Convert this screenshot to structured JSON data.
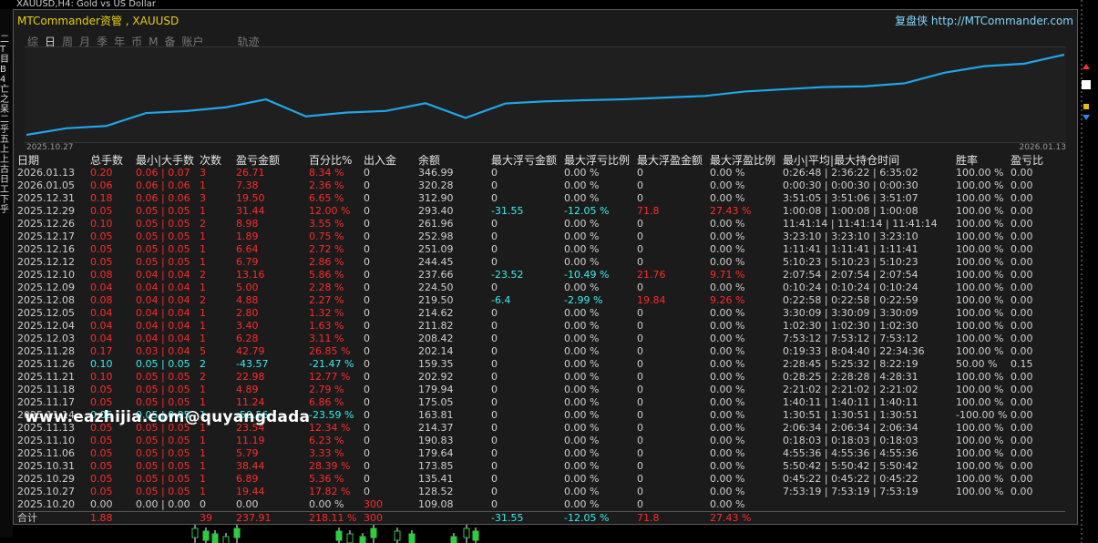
{
  "background": {
    "chart_title": "XAUUSD,H4:  Gold vs US Dollar",
    "left_labels": [
      "二",
      "T",
      "目",
      "B",
      "4",
      "亡",
      "之",
      "呆",
      "二",
      "乎",
      "五",
      "上",
      "上",
      "古",
      "日",
      "工",
      "下",
      "乎"
    ]
  },
  "panel": {
    "title": "MTCommander资管 , XAUUSD",
    "brand": "复盘侠",
    "link": "http://MTCommander.com",
    "tabs": [
      {
        "label": "综"
      },
      {
        "label": "日",
        "active": true
      },
      {
        "label": "周"
      },
      {
        "label": "月"
      },
      {
        "label": "季"
      },
      {
        "label": "年"
      },
      {
        "label": "币"
      },
      {
        "label": "M"
      },
      {
        "label": "备"
      },
      {
        "label": "账户"
      },
      {
        "label": "轨迹"
      }
    ]
  },
  "equity_chart": {
    "date_start": "2025.10.27",
    "date_end": "2026.01.13",
    "line_color": "#1ea6e8"
  },
  "chart_data": {
    "type": "line",
    "x": [
      "2025.10.20",
      "2025.10.27",
      "2025.10.29",
      "2025.10.31",
      "2025.11.06",
      "2025.11.10",
      "2025.11.13",
      "2025.11.14",
      "2025.11.17",
      "2025.11.18",
      "2025.11.21",
      "2025.11.26",
      "2025.11.28",
      "2025.12.03",
      "2025.12.04",
      "2025.12.05",
      "2025.12.08",
      "2025.12.09",
      "2025.12.10",
      "2025.12.12",
      "2025.12.16",
      "2025.12.17",
      "2025.12.26",
      "2025.12.29",
      "2025.12.31",
      "2026.01.05",
      "2026.01.13"
    ],
    "series": [
      {
        "values": [
          109.08,
          128.52,
          135.41,
          173.85,
          179.64,
          190.83,
          214.37,
          163.81,
          175.05,
          179.94,
          202.92,
          159.35,
          202.14,
          208.42,
          211.82,
          214.62,
          219.5,
          224.5,
          237.66,
          244.45,
          251.09,
          252.98,
          261.96,
          293.4,
          312.9,
          320.28,
          346.99
        ]
      }
    ]
  },
  "table": {
    "headers": [
      "日期",
      "总手数",
      "最小|大手数",
      "次数",
      "盈亏金额",
      "百分比%",
      "出入金",
      "余额",
      "最大浮亏金额",
      "最大浮亏比例",
      "最大浮盈金额",
      "最大浮盈比例",
      "最小|平均|最大持仓时间",
      "胜率",
      "盈亏比"
    ],
    "rows": [
      {
        "c": "r",
        "cells": [
          "2026.01.13",
          "0.20",
          "0.06 | 0.07",
          "3",
          "26.71",
          "8.34 %",
          "0",
          "346.99",
          "0",
          "0.00 %",
          "0",
          "0.00 %",
          "0:26:48 | 2:36:22 | 6:35:02",
          "100.00 %",
          "0.00"
        ]
      },
      {
        "c": "r",
        "cells": [
          "2026.01.05",
          "0.06",
          "0.06 | 0.06",
          "1",
          "7.38",
          "2.36 %",
          "0",
          "320.28",
          "0",
          "0.00 %",
          "0",
          "0.00 %",
          "0:00:30 | 0:00:30 | 0:00:30",
          "100.00 %",
          "0.00"
        ]
      },
      {
        "c": "r",
        "cells": [
          "2025.12.31",
          "0.18",
          "0.06 | 0.06",
          "3",
          "19.50",
          "6.65 %",
          "0",
          "312.90",
          "0",
          "0.00 %",
          "0",
          "0.00 %",
          "3:51:05 | 3:51:06 | 3:51:07",
          "100.00 %",
          "0.00"
        ]
      },
      {
        "c": "r",
        "cells": [
          "2025.12.29",
          "0.05",
          "0.05 | 0.05",
          "1",
          "31.44",
          "12.00 %",
          "0",
          "293.40",
          "-31.55",
          "-12.05 %",
          "71.8",
          "27.43 %",
          "1:00:08 | 1:00:08 | 1:00:08",
          "100.00 %",
          "0.00"
        ],
        "fl": true
      },
      {
        "c": "r",
        "cells": [
          "2025.12.26",
          "0.10",
          "0.05 | 0.05",
          "2",
          "8.98",
          "3.55 %",
          "0",
          "261.96",
          "0",
          "0.00 %",
          "0",
          "0.00 %",
          "11:41:14 | 11:41:14 | 11:41:14",
          "100.00 %",
          "0.00"
        ]
      },
      {
        "c": "r",
        "cells": [
          "2025.12.17",
          "0.05",
          "0.05 | 0.05",
          "1",
          "1.89",
          "0.75 %",
          "0",
          "252.98",
          "0",
          "0.00 %",
          "0",
          "0.00 %",
          "3:23:10 | 3:23:10 | 3:23:10",
          "100.00 %",
          "0.00"
        ]
      },
      {
        "c": "r",
        "cells": [
          "2025.12.16",
          "0.05",
          "0.05 | 0.05",
          "1",
          "6.64",
          "2.72 %",
          "0",
          "251.09",
          "0",
          "0.00 %",
          "0",
          "0.00 %",
          "1:11:41 | 1:11:41 | 1:11:41",
          "100.00 %",
          "0.00"
        ]
      },
      {
        "c": "r",
        "cells": [
          "2025.12.12",
          "0.05",
          "0.05 | 0.05",
          "1",
          "6.79",
          "2.86 %",
          "0",
          "244.45",
          "0",
          "0.00 %",
          "0",
          "0.00 %",
          "5:10:23 | 5:10:23 | 5:10:23",
          "100.00 %",
          "0.00"
        ]
      },
      {
        "c": "r",
        "cells": [
          "2025.12.10",
          "0.08",
          "0.04 | 0.04",
          "2",
          "13.16",
          "5.86 %",
          "0",
          "237.66",
          "-23.52",
          "-10.49 %",
          "21.76",
          "9.71 %",
          "2:07:54 | 2:07:54 | 2:07:54",
          "100.00 %",
          "0.00"
        ],
        "fl": true
      },
      {
        "c": "r",
        "cells": [
          "2025.12.09",
          "0.04",
          "0.04 | 0.04",
          "1",
          "5.00",
          "2.28 %",
          "0",
          "224.50",
          "0",
          "0.00 %",
          "0",
          "0.00 %",
          "0:10:24 | 0:10:24 | 0:10:24",
          "100.00 %",
          "0.00"
        ]
      },
      {
        "c": "r",
        "cells": [
          "2025.12.08",
          "0.08",
          "0.04 | 0.04",
          "2",
          "4.88",
          "2.27 %",
          "0",
          "219.50",
          "-6.4",
          "-2.99 %",
          "19.84",
          "9.26 %",
          "0:22:58 | 0:22:58 | 0:22:59",
          "100.00 %",
          "0.00"
        ],
        "fl": true
      },
      {
        "c": "r",
        "cells": [
          "2025.12.05",
          "0.04",
          "0.04 | 0.04",
          "1",
          "2.80",
          "1.32 %",
          "0",
          "214.62",
          "0",
          "0.00 %",
          "0",
          "0.00 %",
          "3:30:09 | 3:30:09 | 3:30:09",
          "100.00 %",
          "0.00"
        ]
      },
      {
        "c": "r",
        "cells": [
          "2025.12.04",
          "0.04",
          "0.04 | 0.04",
          "1",
          "3.40",
          "1.63 %",
          "0",
          "211.82",
          "0",
          "0.00 %",
          "0",
          "0.00 %",
          "1:02:30 | 1:02:30 | 1:02:30",
          "100.00 %",
          "0.00"
        ]
      },
      {
        "c": "r",
        "cells": [
          "2025.12.03",
          "0.04",
          "0.04 | 0.04",
          "1",
          "6.28",
          "3.11 %",
          "0",
          "208.42",
          "0",
          "0.00 %",
          "0",
          "0.00 %",
          "7:53:12 | 7:53:12 | 7:53:12",
          "100.00 %",
          "0.00"
        ]
      },
      {
        "c": "r",
        "cells": [
          "2025.11.28",
          "0.17",
          "0.03 | 0.04",
          "5",
          "42.79",
          "26.85 %",
          "0",
          "202.14",
          "0",
          "0.00 %",
          "0",
          "0.00 %",
          "0:19:33 | 8:04:40 | 22:34:36",
          "100.00 %",
          "0.00"
        ]
      },
      {
        "c": "cy",
        "cells": [
          "2025.11.26",
          "0.10",
          "0.05 | 0.05",
          "2",
          "-43.57",
          "-21.47 %",
          "0",
          "159.35",
          "0",
          "0.00 %",
          "0",
          "0.00 %",
          "2:28:45 | 5:25:32 | 8:22:19",
          "50.00 %",
          "0.15"
        ]
      },
      {
        "c": "r",
        "cells": [
          "2025.11.21",
          "0.10",
          "0.05 | 0.05",
          "2",
          "22.98",
          "12.77 %",
          "0",
          "202.92",
          "0",
          "0.00 %",
          "0",
          "0.00 %",
          "0:28:25 | 2:28:28 | 4:28:31",
          "100.00 %",
          "0.00"
        ]
      },
      {
        "c": "r",
        "cells": [
          "2025.11.18",
          "0.05",
          "0.05 | 0.05",
          "1",
          "4.89",
          "2.79 %",
          "0",
          "179.94",
          "0",
          "0.00 %",
          "0",
          "0.00 %",
          "2:21:02 | 2:21:02 | 2:21:02",
          "100.00 %",
          "0.00"
        ]
      },
      {
        "c": "r",
        "cells": [
          "2025.11.17",
          "0.05",
          "0.05 | 0.05",
          "1",
          "11.24",
          "6.86 %",
          "0",
          "175.05",
          "0",
          "0.00 %",
          "0",
          "0.00 %",
          "1:40:11 | 1:40:11 | 1:40:11",
          "100.00 %",
          "0.00"
        ]
      },
      {
        "c": "cy",
        "cells": [
          "2025.11.14",
          "0.05",
          "0.05 | 0.05",
          "1",
          "-50.56",
          "-23.59 %",
          "0",
          "163.81",
          "0",
          "0.00 %",
          "0",
          "0.00 %",
          "1:30:51 | 1:30:51 | 1:30:51",
          "-100.00 %",
          "0.00"
        ]
      },
      {
        "c": "r",
        "cells": [
          "2025.11.13",
          "0.05",
          "0.05 | 0.05",
          "1",
          "23.54",
          "12.34 %",
          "0",
          "214.37",
          "0",
          "0.00 %",
          "0",
          "0.00 %",
          "2:06:34 | 2:06:34 | 2:06:34",
          "100.00 %",
          "0.00"
        ]
      },
      {
        "c": "r",
        "cells": [
          "2025.11.10",
          "0.05",
          "0.05 | 0.05",
          "1",
          "11.19",
          "6.23 %",
          "0",
          "190.83",
          "0",
          "0.00 %",
          "0",
          "0.00 %",
          "0:18:03 | 0:18:03 | 0:18:03",
          "100.00 %",
          "0.00"
        ]
      },
      {
        "c": "r",
        "cells": [
          "2025.11.06",
          "0.05",
          "0.05 | 0.05",
          "1",
          "5.79",
          "3.33 %",
          "0",
          "179.64",
          "0",
          "0.00 %",
          "0",
          "0.00 %",
          "4:55:36 | 4:55:36 | 4:55:36",
          "100.00 %",
          "0.00"
        ]
      },
      {
        "c": "r",
        "cells": [
          "2025.10.31",
          "0.05",
          "0.05 | 0.05",
          "1",
          "38.44",
          "28.39 %",
          "0",
          "173.85",
          "0",
          "0.00 %",
          "0",
          "0.00 %",
          "5:50:42 | 5:50:42 | 5:50:42",
          "100.00 %",
          "0.00"
        ]
      },
      {
        "c": "r",
        "cells": [
          "2025.10.29",
          "0.05",
          "0.05 | 0.05",
          "1",
          "6.89",
          "5.36 %",
          "0",
          "135.41",
          "0",
          "0.00 %",
          "0",
          "0.00 %",
          "0:45:22 | 0:45:22 | 0:45:22",
          "100.00 %",
          "0.00"
        ]
      },
      {
        "c": "r",
        "cells": [
          "2025.10.27",
          "0.05",
          "0.05 | 0.05",
          "1",
          "19.44",
          "17.82 %",
          "0",
          "128.52",
          "0",
          "0.00 %",
          "0",
          "0.00 %",
          "7:53:19 | 7:53:19 | 7:53:19",
          "100.00 %",
          "0.00"
        ]
      },
      {
        "c": "w",
        "cells": [
          "2025.10.20",
          "0.00",
          "0.00 | 0.00",
          "0",
          "0.00",
          "0.00 %",
          "300",
          "109.08",
          "0",
          "0.00 %",
          "0",
          "0.00 %",
          "",
          "",
          ""
        ],
        "dep": true
      }
    ],
    "total": [
      "合计",
      "1.88",
      "",
      "39",
      "237.91",
      "218.11 %",
      "300",
      "",
      "-31.55",
      "-12.05 %",
      "71.8",
      "27.43 %",
      "",
      "",
      ""
    ]
  },
  "watermark": "www.eazhijia.com@quyangdada"
}
